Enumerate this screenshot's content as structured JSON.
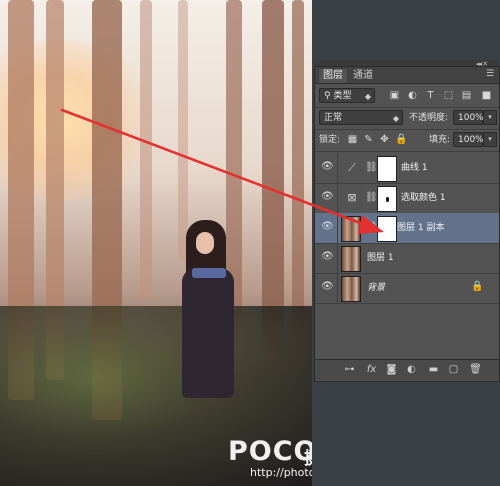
{
  "panel": {
    "tabs": [
      {
        "label": "图层"
      },
      {
        "label": "通道"
      }
    ],
    "filter": {
      "label": "类型"
    },
    "blend_mode": {
      "value": "正常"
    },
    "opacity": {
      "label": "不透明度:",
      "value": "100%"
    },
    "lock": {
      "label": "锁定:"
    },
    "fill": {
      "label": "填充:",
      "value": "100%"
    },
    "layers": [
      {
        "name": "曲线 1",
        "type": "curves-adjustment",
        "visible": true
      },
      {
        "name": "选取颜色 1",
        "type": "selective-color-adjustment",
        "visible": true
      },
      {
        "name": "图层 1 副本",
        "type": "pixel-with-mask",
        "visible": true,
        "selected": true
      },
      {
        "name": "图层 1",
        "type": "pixel",
        "visible": true
      },
      {
        "name": "背景",
        "type": "background",
        "visible": true,
        "locked": true
      }
    ],
    "footer_icons": [
      "link-icon",
      "fx-icon",
      "mask-icon",
      "adjustment-icon",
      "folder-icon",
      "new-layer-icon",
      "trash-icon"
    ]
  },
  "annotation": {
    "arrow_color": "#e53030"
  },
  "watermark": {
    "logo": "POCO",
    "tagline": "摄影专题",
    "url": "http://photo.poco.cn/"
  },
  "colors": {
    "panel_bg": "#535353",
    "selected_layer": "#63738c",
    "arrow": "#e53030"
  }
}
